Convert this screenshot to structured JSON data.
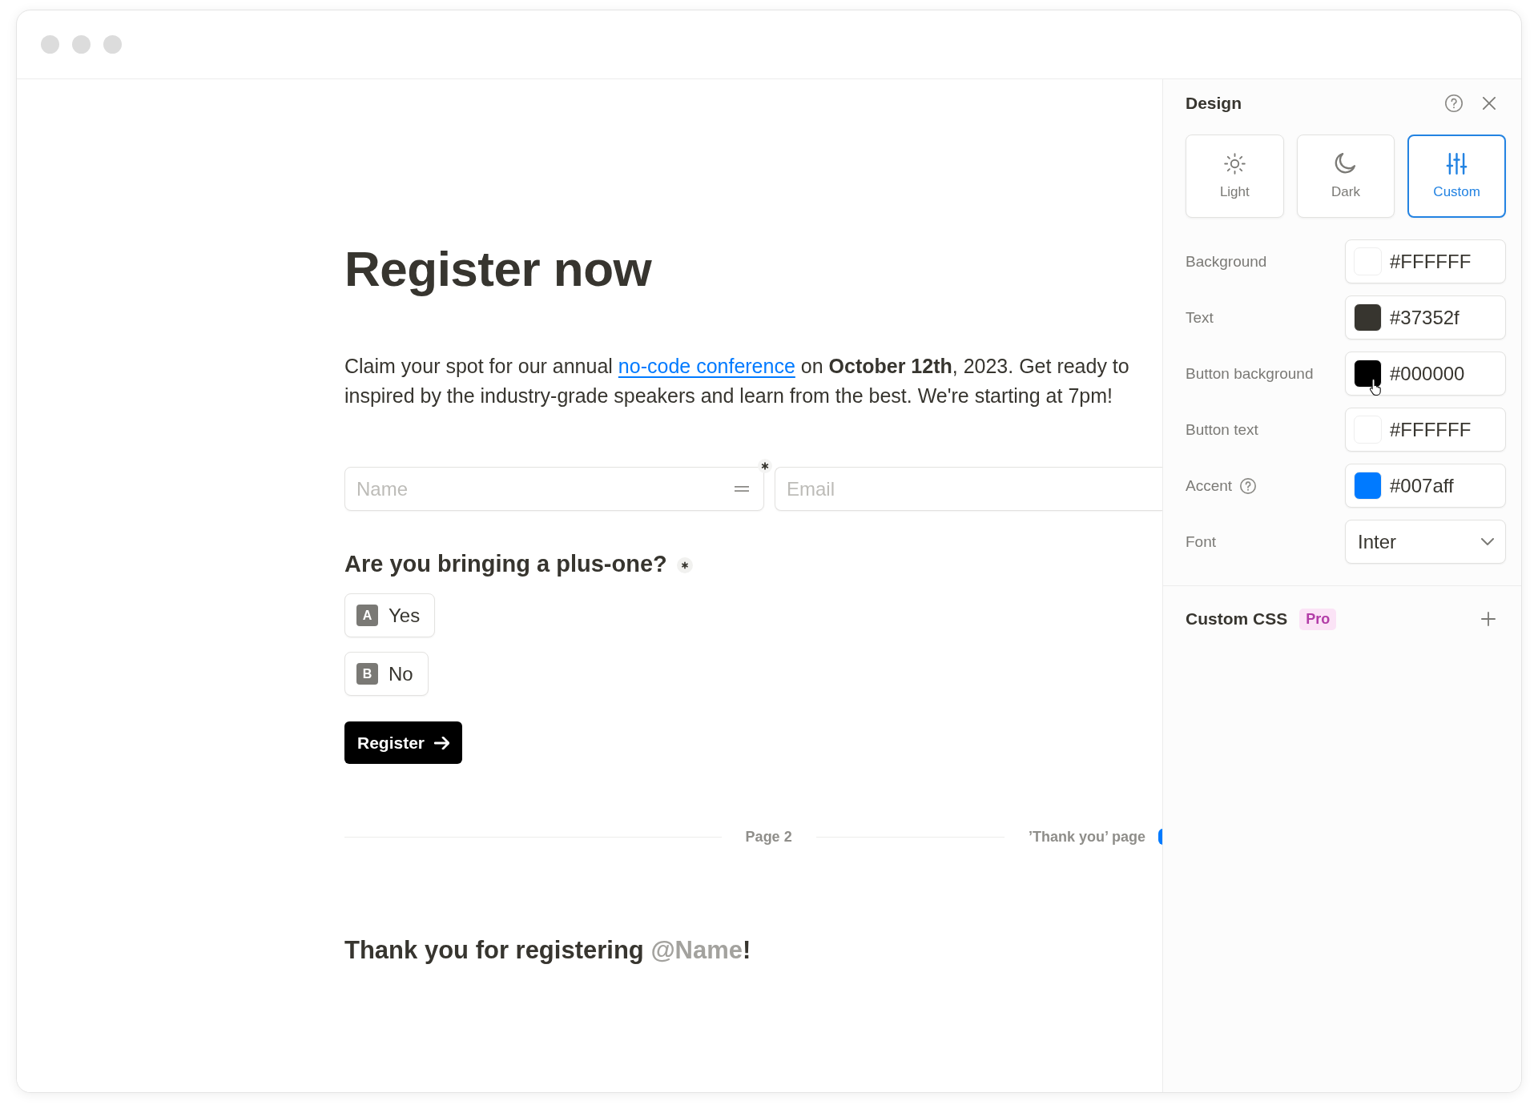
{
  "form": {
    "title": "Register now",
    "intro": {
      "before": "Claim your spot for our annual",
      "link": "no-code conference",
      "after": "on **October 12th**, 2023. Get ready to inspired by the industry-grade speakers and learn from the best. We're starting at 7pm!"
    },
    "fields": [
      {
        "placeholder": "Name",
        "required": true,
        "handle": true
      },
      {
        "placeholder": "Email",
        "required": false,
        "handle": false
      }
    ],
    "question": {
      "text": "Are you bringing a plus-one?",
      "required": true,
      "options": [
        {
          "key": "A",
          "label": "Yes",
          "selected": false
        },
        {
          "key": "B",
          "label": "No",
          "selected": false
        }
      ]
    },
    "submit": "Register",
    "page_breaks": [
      {
        "label": "Page 2",
        "marker": false
      },
      {
        "label": "’Thank you’ page",
        "marker": true
      }
    ],
    "thank_you": {
      "before": "Thank you for registering",
      "mention": "@Name",
      "after": "!"
    }
  },
  "design": {
    "title": "Design",
    "modes": [
      {
        "label": "Light",
        "selected": false
      },
      {
        "label": "Dark",
        "selected": false
      },
      {
        "label": "Custom",
        "selected": true
      }
    ],
    "settings": [
      {
        "kind": "color",
        "label": "Background",
        "value": "#FFFFFF",
        "help": false,
        "hovered": false
      },
      {
        "kind": "color",
        "label": "Text",
        "value": "#37352f",
        "help": false,
        "hovered": false
      },
      {
        "kind": "color",
        "label": "Button background",
        "value": "#000000",
        "help": false,
        "hovered": true
      },
      {
        "kind": "color",
        "label": "Button text",
        "value": "#FFFFFF",
        "help": false,
        "hovered": false
      },
      {
        "kind": "color",
        "label": "Accent",
        "value": "#007aff",
        "help": true,
        "hovered": false
      },
      {
        "kind": "select",
        "label": "Font",
        "value": "Inter",
        "help": false,
        "hovered": false
      }
    ],
    "custom_css": {
      "label": "Custom CSS",
      "badge": "Pro"
    }
  }
}
